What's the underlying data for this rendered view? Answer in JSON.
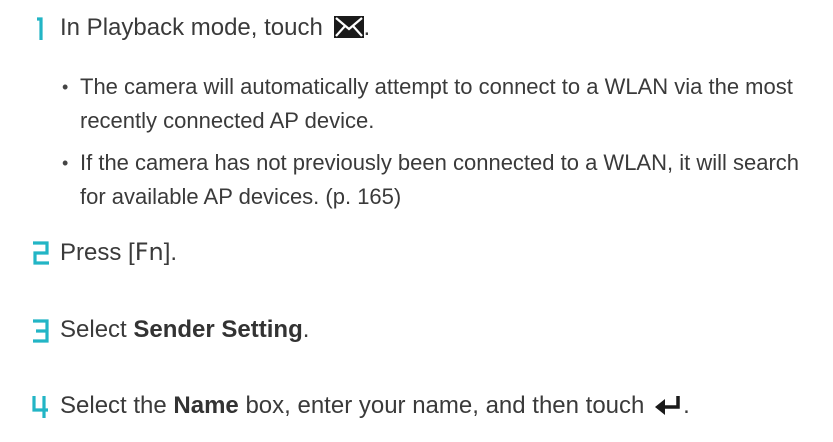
{
  "steps": [
    {
      "number": "1",
      "text": "In Playback mode, touch",
      "icon": "mail-icon",
      "trailing": ".",
      "bullets": [
        "The camera will automatically attempt to connect to a WLAN via the most recently connected AP device.",
        "If the camera has not previously been connected to a WLAN, it will search for available AP devices. (p. 165)"
      ]
    },
    {
      "number": "2",
      "prefix": "Press [",
      "key": "Fn",
      "suffix": "]."
    },
    {
      "number": "3",
      "prefix": "Select ",
      "bold": "Sender Setting",
      "suffix": "."
    },
    {
      "number": "4",
      "prefix": "Select the ",
      "bold": "Name",
      "middle": " box, enter your name, and then touch",
      "icon": "enter-return-icon",
      "trailing": "."
    }
  ],
  "colors": {
    "step_number": "#22b5c5",
    "text": "#3a3a3a",
    "icon": "#1a1a1a"
  },
  "bullet_glyph": "•"
}
